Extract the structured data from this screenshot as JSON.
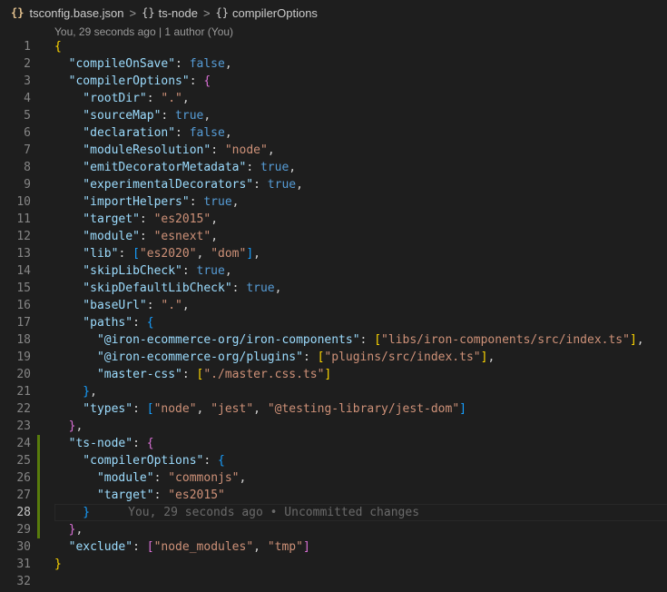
{
  "breadcrumb": {
    "file_icon": "{}",
    "file": "tsconfig.base.json",
    "sep": ">",
    "obj_icon": "{}",
    "item1": "ts-node",
    "item2": "compilerOptions"
  },
  "codelens": "You, 29 seconds ago | 1 author (You)",
  "blame": "You, 29 seconds ago • Uncommitted changes",
  "colors": {
    "key": "#9cdcfe",
    "string": "#ce9178",
    "boolean": "#569cd6",
    "bracket_level1": "#ffd700",
    "bracket_level2": "#da70d6",
    "bracket_level3": "#179fff",
    "gutter_modified": "#587c0c"
  },
  "lines": [
    {
      "n": "1",
      "indent": 0,
      "t": [
        [
          "br1",
          "{"
        ]
      ]
    },
    {
      "n": "2",
      "indent": 1,
      "t": [
        [
          "k",
          "\"compileOnSave\""
        ],
        [
          "p",
          ": "
        ],
        [
          "b",
          "false"
        ],
        [
          "p",
          ","
        ]
      ]
    },
    {
      "n": "3",
      "indent": 1,
      "t": [
        [
          "k",
          "\"compilerOptions\""
        ],
        [
          "p",
          ": "
        ],
        [
          "br2",
          "{"
        ]
      ]
    },
    {
      "n": "4",
      "indent": 2,
      "t": [
        [
          "k",
          "\"rootDir\""
        ],
        [
          "p",
          ": "
        ],
        [
          "s",
          "\".\""
        ],
        [
          "p",
          ","
        ]
      ]
    },
    {
      "n": "5",
      "indent": 2,
      "t": [
        [
          "k",
          "\"sourceMap\""
        ],
        [
          "p",
          ": "
        ],
        [
          "b",
          "true"
        ],
        [
          "p",
          ","
        ]
      ]
    },
    {
      "n": "6",
      "indent": 2,
      "t": [
        [
          "k",
          "\"declaration\""
        ],
        [
          "p",
          ": "
        ],
        [
          "b",
          "false"
        ],
        [
          "p",
          ","
        ]
      ]
    },
    {
      "n": "7",
      "indent": 2,
      "t": [
        [
          "k",
          "\"moduleResolution\""
        ],
        [
          "p",
          ": "
        ],
        [
          "s",
          "\"node\""
        ],
        [
          "p",
          ","
        ]
      ]
    },
    {
      "n": "8",
      "indent": 2,
      "t": [
        [
          "k",
          "\"emitDecoratorMetadata\""
        ],
        [
          "p",
          ": "
        ],
        [
          "b",
          "true"
        ],
        [
          "p",
          ","
        ]
      ]
    },
    {
      "n": "9",
      "indent": 2,
      "t": [
        [
          "k",
          "\"experimentalDecorators\""
        ],
        [
          "p",
          ": "
        ],
        [
          "b",
          "true"
        ],
        [
          "p",
          ","
        ]
      ]
    },
    {
      "n": "10",
      "indent": 2,
      "t": [
        [
          "k",
          "\"importHelpers\""
        ],
        [
          "p",
          ": "
        ],
        [
          "b",
          "true"
        ],
        [
          "p",
          ","
        ]
      ]
    },
    {
      "n": "11",
      "indent": 2,
      "t": [
        [
          "k",
          "\"target\""
        ],
        [
          "p",
          ": "
        ],
        [
          "s",
          "\"es2015\""
        ],
        [
          "p",
          ","
        ]
      ]
    },
    {
      "n": "12",
      "indent": 2,
      "t": [
        [
          "k",
          "\"module\""
        ],
        [
          "p",
          ": "
        ],
        [
          "s",
          "\"esnext\""
        ],
        [
          "p",
          ","
        ]
      ]
    },
    {
      "n": "13",
      "indent": 2,
      "t": [
        [
          "k",
          "\"lib\""
        ],
        [
          "p",
          ": "
        ],
        [
          "br3",
          "["
        ],
        [
          "s",
          "\"es2020\""
        ],
        [
          "p",
          ", "
        ],
        [
          "s",
          "\"dom\""
        ],
        [
          "br3",
          "]"
        ],
        [
          "p",
          ","
        ]
      ]
    },
    {
      "n": "14",
      "indent": 2,
      "t": [
        [
          "k",
          "\"skipLibCheck\""
        ],
        [
          "p",
          ": "
        ],
        [
          "b",
          "true"
        ],
        [
          "p",
          ","
        ]
      ]
    },
    {
      "n": "15",
      "indent": 2,
      "t": [
        [
          "k",
          "\"skipDefaultLibCheck\""
        ],
        [
          "p",
          ": "
        ],
        [
          "b",
          "true"
        ],
        [
          "p",
          ","
        ]
      ]
    },
    {
      "n": "16",
      "indent": 2,
      "t": [
        [
          "k",
          "\"baseUrl\""
        ],
        [
          "p",
          ": "
        ],
        [
          "s",
          "\".\""
        ],
        [
          "p",
          ","
        ]
      ]
    },
    {
      "n": "17",
      "indent": 2,
      "t": [
        [
          "k",
          "\"paths\""
        ],
        [
          "p",
          ": "
        ],
        [
          "br3",
          "{"
        ]
      ]
    },
    {
      "n": "18",
      "indent": 3,
      "t": [
        [
          "k",
          "\"@iron-ecommerce-org/iron-components\""
        ],
        [
          "p",
          ": "
        ],
        [
          "br1",
          "["
        ],
        [
          "s",
          "\"libs/iron-components/src/index.ts\""
        ],
        [
          "br1",
          "]"
        ],
        [
          "p",
          ","
        ]
      ]
    },
    {
      "n": "19",
      "indent": 3,
      "t": [
        [
          "k",
          "\"@iron-ecommerce-org/plugins\""
        ],
        [
          "p",
          ": "
        ],
        [
          "br1",
          "["
        ],
        [
          "s",
          "\"plugins/src/index.ts\""
        ],
        [
          "br1",
          "]"
        ],
        [
          "p",
          ","
        ]
      ]
    },
    {
      "n": "20",
      "indent": 3,
      "t": [
        [
          "k",
          "\"master-css\""
        ],
        [
          "p",
          ": "
        ],
        [
          "br1",
          "["
        ],
        [
          "s",
          "\"./master.css.ts\""
        ],
        [
          "br1",
          "]"
        ]
      ]
    },
    {
      "n": "21",
      "indent": 2,
      "t": [
        [
          "br3",
          "}"
        ],
        [
          "p",
          ","
        ]
      ]
    },
    {
      "n": "22",
      "indent": 2,
      "t": [
        [
          "k",
          "\"types\""
        ],
        [
          "p",
          ": "
        ],
        [
          "br3",
          "["
        ],
        [
          "s",
          "\"node\""
        ],
        [
          "p",
          ", "
        ],
        [
          "s",
          "\"jest\""
        ],
        [
          "p",
          ", "
        ],
        [
          "s",
          "\"@testing-library/jest-dom\""
        ],
        [
          "br3",
          "]"
        ]
      ]
    },
    {
      "n": "23",
      "indent": 1,
      "t": [
        [
          "br2",
          "}"
        ],
        [
          "p",
          ","
        ]
      ]
    },
    {
      "n": "24",
      "indent": 1,
      "mod": true,
      "t": [
        [
          "k",
          "\"ts-node\""
        ],
        [
          "p",
          ": "
        ],
        [
          "br2",
          "{"
        ]
      ]
    },
    {
      "n": "25",
      "indent": 2,
      "mod": true,
      "t": [
        [
          "k",
          "\"compilerOptions\""
        ],
        [
          "p",
          ": "
        ],
        [
          "br3",
          "{"
        ]
      ]
    },
    {
      "n": "26",
      "indent": 3,
      "mod": true,
      "t": [
        [
          "k",
          "\"module\""
        ],
        [
          "p",
          ": "
        ],
        [
          "s",
          "\"commonjs\""
        ],
        [
          "p",
          ","
        ]
      ]
    },
    {
      "n": "27",
      "indent": 3,
      "mod": true,
      "t": [
        [
          "k",
          "\"target\""
        ],
        [
          "p",
          ": "
        ],
        [
          "s",
          "\"es2015\""
        ]
      ]
    },
    {
      "n": "28",
      "indent": 2,
      "mod": true,
      "current": true,
      "t": [
        [
          "br3",
          "}"
        ]
      ]
    },
    {
      "n": "29",
      "indent": 1,
      "mod": true,
      "t": [
        [
          "br2",
          "}"
        ],
        [
          "p",
          ","
        ]
      ]
    },
    {
      "n": "30",
      "indent": 1,
      "t": [
        [
          "k",
          "\"exclude\""
        ],
        [
          "p",
          ": "
        ],
        [
          "br2",
          "["
        ],
        [
          "s",
          "\"node_modules\""
        ],
        [
          "p",
          ", "
        ],
        [
          "s",
          "\"tmp\""
        ],
        [
          "br2",
          "]"
        ]
      ]
    },
    {
      "n": "31",
      "indent": 0,
      "t": [
        [
          "br1",
          "}"
        ]
      ]
    },
    {
      "n": "32",
      "indent": 0,
      "t": []
    }
  ]
}
